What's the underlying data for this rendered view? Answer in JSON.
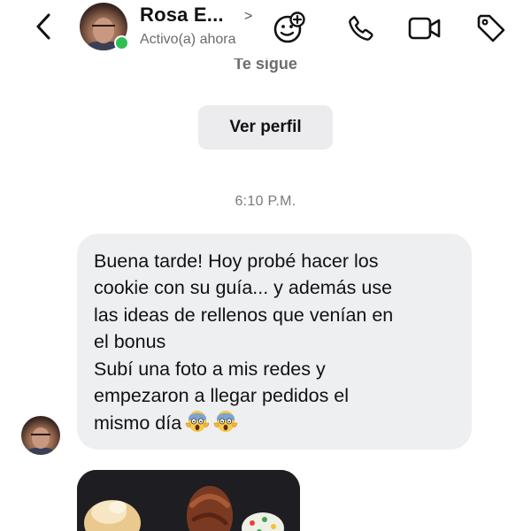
{
  "header": {
    "contact_name": "Rosa E...",
    "name_chevron": ">",
    "status": "Activo(a) ahora",
    "icons": [
      "back-chevron-icon",
      "avatar",
      "sticker-add-icon",
      "phone-icon",
      "video-camera-icon",
      "tag-icon"
    ]
  },
  "conversation": {
    "follows_text": "Te sigue",
    "view_profile_label": "Ver perfil",
    "timestamp": "6:10 P.M.",
    "message": {
      "lines": [
        "Buena tarde! Hoy probé hacer los",
        "cookie con su guía... y además use",
        "las ideas de rellenos que venían en",
        "el bonus",
        "Subí una foto a mis redes y",
        "empezaron a llegar pedidos el",
        "mismo día"
      ],
      "emojis": [
        "scream-emoji",
        "scream-emoji"
      ]
    }
  },
  "colors": {
    "online": "#2fbf56",
    "bubble": "#eeeff1",
    "profile_button": "#ececef"
  }
}
